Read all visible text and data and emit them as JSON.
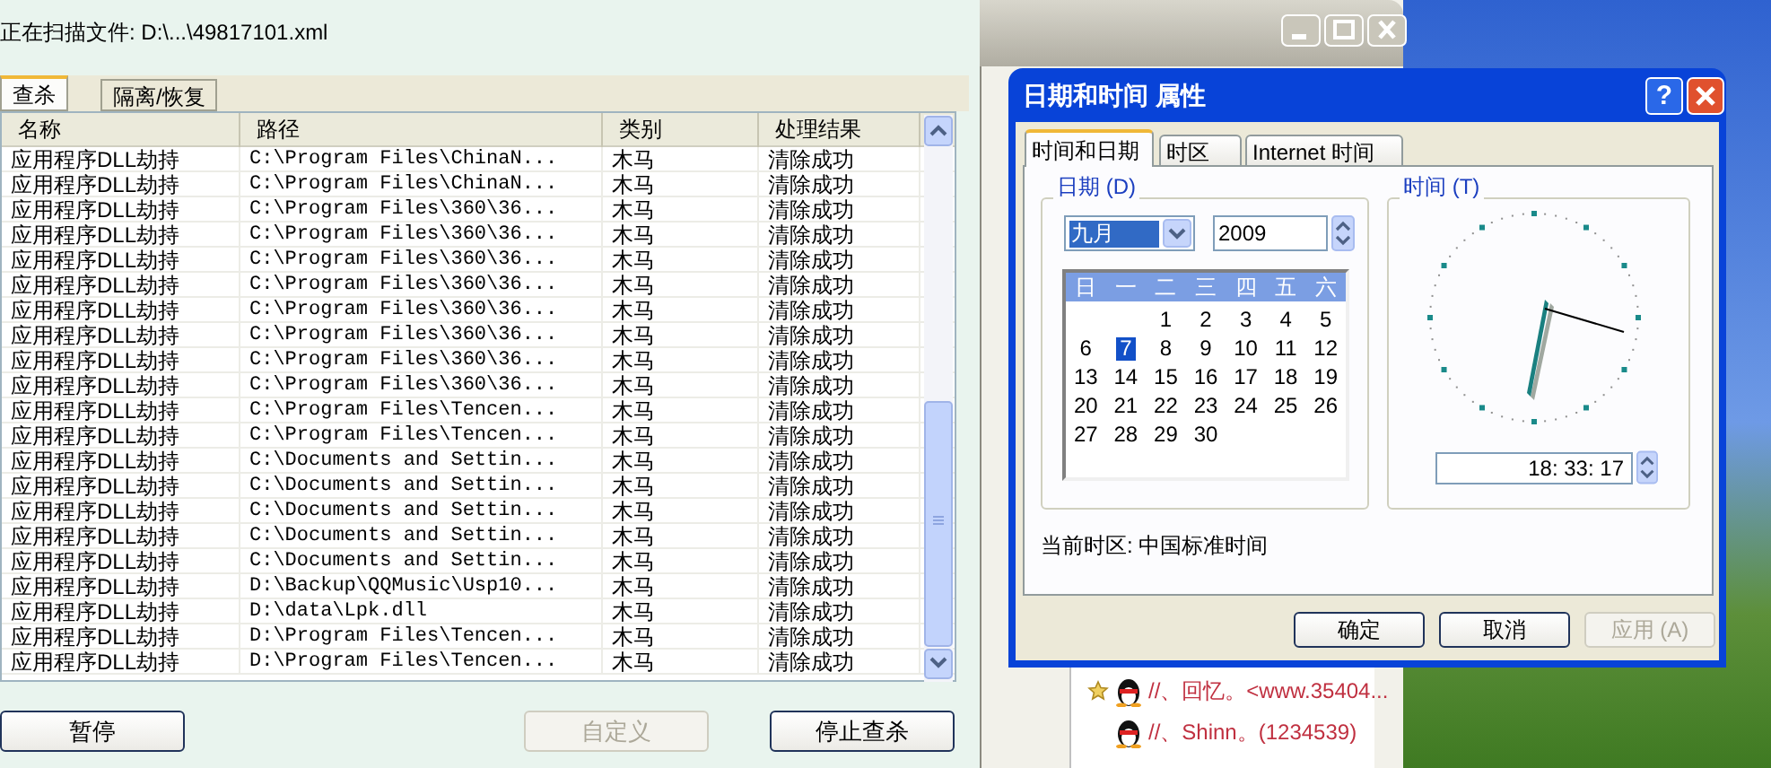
{
  "scanner": {
    "scan_status": "正在扫描文件: D:\\...\\49817101.xml",
    "tabs": [
      {
        "label": "查杀",
        "selected": true
      },
      {
        "label": "隔离/恢复",
        "selected": false
      }
    ],
    "table": {
      "columns": [
        "名称",
        "路径",
        "类别",
        "处理结果"
      ],
      "rows": [
        [
          "应用程序DLL劫持",
          "C:\\Program Files\\ChinaN...",
          "木马",
          "清除成功"
        ],
        [
          "应用程序DLL劫持",
          "C:\\Program Files\\ChinaN...",
          "木马",
          "清除成功"
        ],
        [
          "应用程序DLL劫持",
          "C:\\Program Files\\360\\36...",
          "木马",
          "清除成功"
        ],
        [
          "应用程序DLL劫持",
          "C:\\Program Files\\360\\36...",
          "木马",
          "清除成功"
        ],
        [
          "应用程序DLL劫持",
          "C:\\Program Files\\360\\36...",
          "木马",
          "清除成功"
        ],
        [
          "应用程序DLL劫持",
          "C:\\Program Files\\360\\36...",
          "木马",
          "清除成功"
        ],
        [
          "应用程序DLL劫持",
          "C:\\Program Files\\360\\36...",
          "木马",
          "清除成功"
        ],
        [
          "应用程序DLL劫持",
          "C:\\Program Files\\360\\36...",
          "木马",
          "清除成功"
        ],
        [
          "应用程序DLL劫持",
          "C:\\Program Files\\360\\36...",
          "木马",
          "清除成功"
        ],
        [
          "应用程序DLL劫持",
          "C:\\Program Files\\360\\36...",
          "木马",
          "清除成功"
        ],
        [
          "应用程序DLL劫持",
          "C:\\Program Files\\Tencen...",
          "木马",
          "清除成功"
        ],
        [
          "应用程序DLL劫持",
          "C:\\Program Files\\Tencen...",
          "木马",
          "清除成功"
        ],
        [
          "应用程序DLL劫持",
          "C:\\Documents and Settin...",
          "木马",
          "清除成功"
        ],
        [
          "应用程序DLL劫持",
          "C:\\Documents and Settin...",
          "木马",
          "清除成功"
        ],
        [
          "应用程序DLL劫持",
          "C:\\Documents and Settin...",
          "木马",
          "清除成功"
        ],
        [
          "应用程序DLL劫持",
          "C:\\Documents and Settin...",
          "木马",
          "清除成功"
        ],
        [
          "应用程序DLL劫持",
          "C:\\Documents and Settin...",
          "木马",
          "清除成功"
        ],
        [
          "应用程序DLL劫持",
          "D:\\Backup\\QQMusic\\Usp10...",
          "木马",
          "清除成功"
        ],
        [
          "应用程序DLL劫持",
          "D:\\data\\Lpk.dll",
          "木马",
          "清除成功"
        ],
        [
          "应用程序DLL劫持",
          "D:\\Program Files\\Tencen...",
          "木马",
          "清除成功"
        ],
        [
          "应用程序DLL劫持",
          "D:\\Program Files\\Tencen...",
          "木马",
          "清除成功"
        ]
      ]
    },
    "buttons": [
      {
        "label": "暂停",
        "disabled": false
      },
      {
        "label": "自定义",
        "disabled": true
      },
      {
        "label": "停止查杀",
        "disabled": false
      }
    ]
  },
  "dialog": {
    "title": "日期和时间 属性",
    "help_button": "?",
    "tabs": [
      {
        "label": "时间和日期",
        "selected": true
      },
      {
        "label": "时区",
        "selected": false
      },
      {
        "label": "Internet 时间",
        "selected": false
      }
    ],
    "date_group": {
      "label": "日期 (D)",
      "month": "九月",
      "year": "2009",
      "weekdays": [
        "日",
        "一",
        "二",
        "三",
        "四",
        "五",
        "六"
      ],
      "weeks": [
        [
          {
            "day": "1",
            "selected": false
          },
          {
            "day": "2",
            "selected": false
          },
          {
            "day": "3",
            "selected": false
          },
          {
            "day": "4",
            "selected": false
          },
          {
            "day": "5",
            "selected": false
          }
        ],
        [
          {
            "day": "6",
            "selected": false
          },
          {
            "day": "7",
            "selected": true
          },
          {
            "day": "8",
            "selected": false
          },
          {
            "day": "9",
            "selected": false
          },
          {
            "day": "10",
            "selected": false
          },
          {
            "day": "11",
            "selected": false
          },
          {
            "day": "12",
            "selected": false
          }
        ],
        [
          {
            "day": "13",
            "selected": false
          },
          {
            "day": "14",
            "selected": false
          },
          {
            "day": "15",
            "selected": false
          },
          {
            "day": "16",
            "selected": false
          },
          {
            "day": "17",
            "selected": false
          },
          {
            "day": "18",
            "selected": false
          },
          {
            "day": "19",
            "selected": false
          }
        ],
        [
          {
            "day": "20",
            "selected": false
          },
          {
            "day": "21",
            "selected": false
          },
          {
            "day": "22",
            "selected": false
          },
          {
            "day": "23",
            "selected": false
          },
          {
            "day": "24",
            "selected": false
          },
          {
            "day": "25",
            "selected": false
          },
          {
            "day": "26",
            "selected": false
          }
        ],
        [
          {
            "day": "27",
            "selected": false
          },
          {
            "day": "28",
            "selected": false
          },
          {
            "day": "29",
            "selected": false
          },
          {
            "day": "30",
            "selected": false
          }
        ]
      ]
    },
    "time_group": {
      "label": "时间 (T)",
      "time": "18: 33: 17"
    },
    "timezone": "当前时区: 中国标准时间",
    "buttons": [
      {
        "label": "确定",
        "disabled": false
      },
      {
        "label": "取消",
        "disabled": false
      },
      {
        "label": "应用 (A)",
        "disabled": true
      }
    ]
  },
  "contacts": [
    {
      "name": "//、回忆。<www.35404...",
      "starred": true
    },
    {
      "name": "//、Shinn。(1234539)",
      "starred": false
    }
  ]
}
